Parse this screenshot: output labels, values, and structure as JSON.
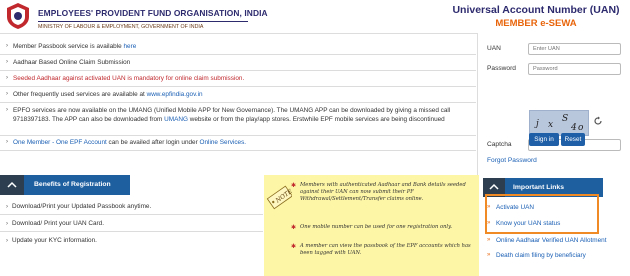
{
  "header": {
    "org_title": "EMPLOYEES' PROVIDENT FUND ORGANISATION, INDIA",
    "org_subtitle": "MINISTRY OF LABOUR & EMPLOYMENT, GOVERNMENT OF INDIA",
    "portal_title": "Universal Account Number (UAN)",
    "portal_subtitle": "MEMBER e-SEWA"
  },
  "notices": [
    {
      "text": "Member Passbook service is available ",
      "link": "here"
    },
    {
      "text": "Aadhaar Based Online Claim Submission"
    },
    {
      "text": "Seeded Aadhaar against activated UAN is mandatory for online claim submission.",
      "style": "red"
    },
    {
      "text": "Other frequently used services are available at ",
      "link": "www.epfindia.gov.in"
    },
    {
      "text": "EPFO services are now available on the UMANG (Unified Mobile APP for New Governance). The UMANG APP can be downloaded by giving a missed call 9718397183. The APP can also be downloaded from ",
      "link": "UMANG",
      "text_after": " website or from the play/app stores. Erstwhile EPF mobile services are being discontinued"
    },
    {
      "link": "One Member - One EPF Account",
      "text_after": " can be availed after login under ",
      "link2": "Online Services."
    }
  ],
  "login": {
    "uan_label": "UAN",
    "uan_placeholder": "Enter UAN",
    "password_label": "Password",
    "password_placeholder": "Password",
    "captcha_label": "Captcha",
    "captcha_text": [
      "j",
      "x",
      "S",
      "4",
      "o"
    ],
    "sign_in": "Sign in",
    "reset": "Reset",
    "forgot": "Forgot Password"
  },
  "benefits": {
    "title": "Benefits of Registration",
    "items": [
      "Download/Print your Updated Passbook anytime.",
      "Download/ Print your UAN Card.",
      "Update your KYC information."
    ]
  },
  "note": {
    "tag": "NOTE",
    "items": [
      "Members with authenticated Aadhaar and Bank details seeded against their UAN can now submit their PF Withdrawal/Settlement/Transfer claims online.",
      "One mobile number can be used for one registration only.",
      "A member can view the passbook of the EPF accounts which has been tagged with UAN."
    ]
  },
  "important_links": {
    "title": "Important Links",
    "items": [
      "Activate UAN",
      "Know your UAN status",
      "Online Aadhaar Verified UAN Allotment",
      "Death claim filing by beneficiary"
    ]
  },
  "colors": {
    "brand_blue": "#1e5fa0",
    "accent_orange": "#e8650c",
    "highlight": "#f08a24",
    "note_bg": "#fdf6a6"
  }
}
